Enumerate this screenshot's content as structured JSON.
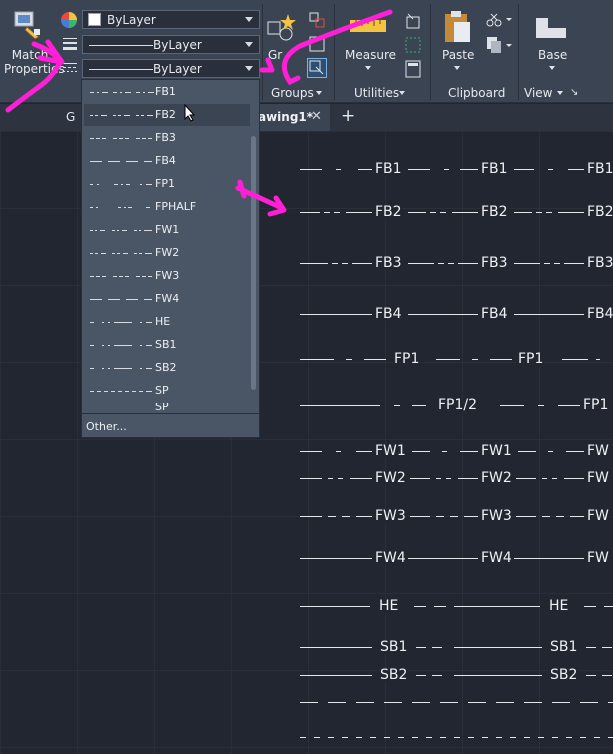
{
  "ribbon": {
    "match_properties": "Match Properties",
    "color_combo": "ByLayer",
    "lineweight_combo": "ByLayer",
    "linetype_combo": "ByLayer",
    "groups_button_fragment": "Gr",
    "measure_label": "Measure",
    "paste_label": "Paste",
    "base_label": "Base",
    "panels": {
      "groups": "Groups",
      "utilities": "Utilities",
      "clipboard": "Clipboard",
      "view": "View"
    }
  },
  "tabs": {
    "partial_left": "G",
    "active": "awing1*",
    "close": "✕",
    "new": "+"
  },
  "linetype_dropdown": {
    "items": [
      "FB1",
      "FB2",
      "FB3",
      "FB4",
      "FP1",
      "FPHALF",
      "FW1",
      "FW2",
      "FW3",
      "FW4",
      "HE",
      "SB1",
      "SB2",
      "SP",
      "SP"
    ],
    "highlighted_index": 1,
    "other": "Other..."
  },
  "drawing": {
    "rows": [
      {
        "labels": [
          "FB1",
          "FB1",
          "FB1"
        ]
      },
      {
        "labels": [
          "FB2",
          "FB2",
          "FB2"
        ]
      },
      {
        "labels": [
          "FB3",
          "FB3",
          "FB3"
        ]
      },
      {
        "labels": [
          "FB4",
          "FB4",
          "FB4"
        ]
      },
      {
        "labels": [
          "FP1",
          "FP1"
        ]
      },
      {
        "labels": [
          "FP1/2",
          "FP1"
        ]
      },
      {
        "labels": [
          "FW1",
          "FW1",
          "FW"
        ]
      },
      {
        "labels": [
          "FW2",
          "FW2",
          "FW"
        ]
      },
      {
        "labels": [
          "FW3",
          "FW3",
          "FW"
        ]
      },
      {
        "labels": [
          "FW4",
          "FW4",
          "FW"
        ]
      },
      {
        "labels": [
          "HE",
          "HE"
        ]
      },
      {
        "labels": [
          "SB1",
          "SB1"
        ]
      },
      {
        "labels": [
          "SB2",
          "SB2"
        ]
      }
    ]
  },
  "colors": {
    "ribbon_bg": "#3b4453",
    "canvas_bg": "#212630",
    "annotation": "#ff1fd6"
  }
}
